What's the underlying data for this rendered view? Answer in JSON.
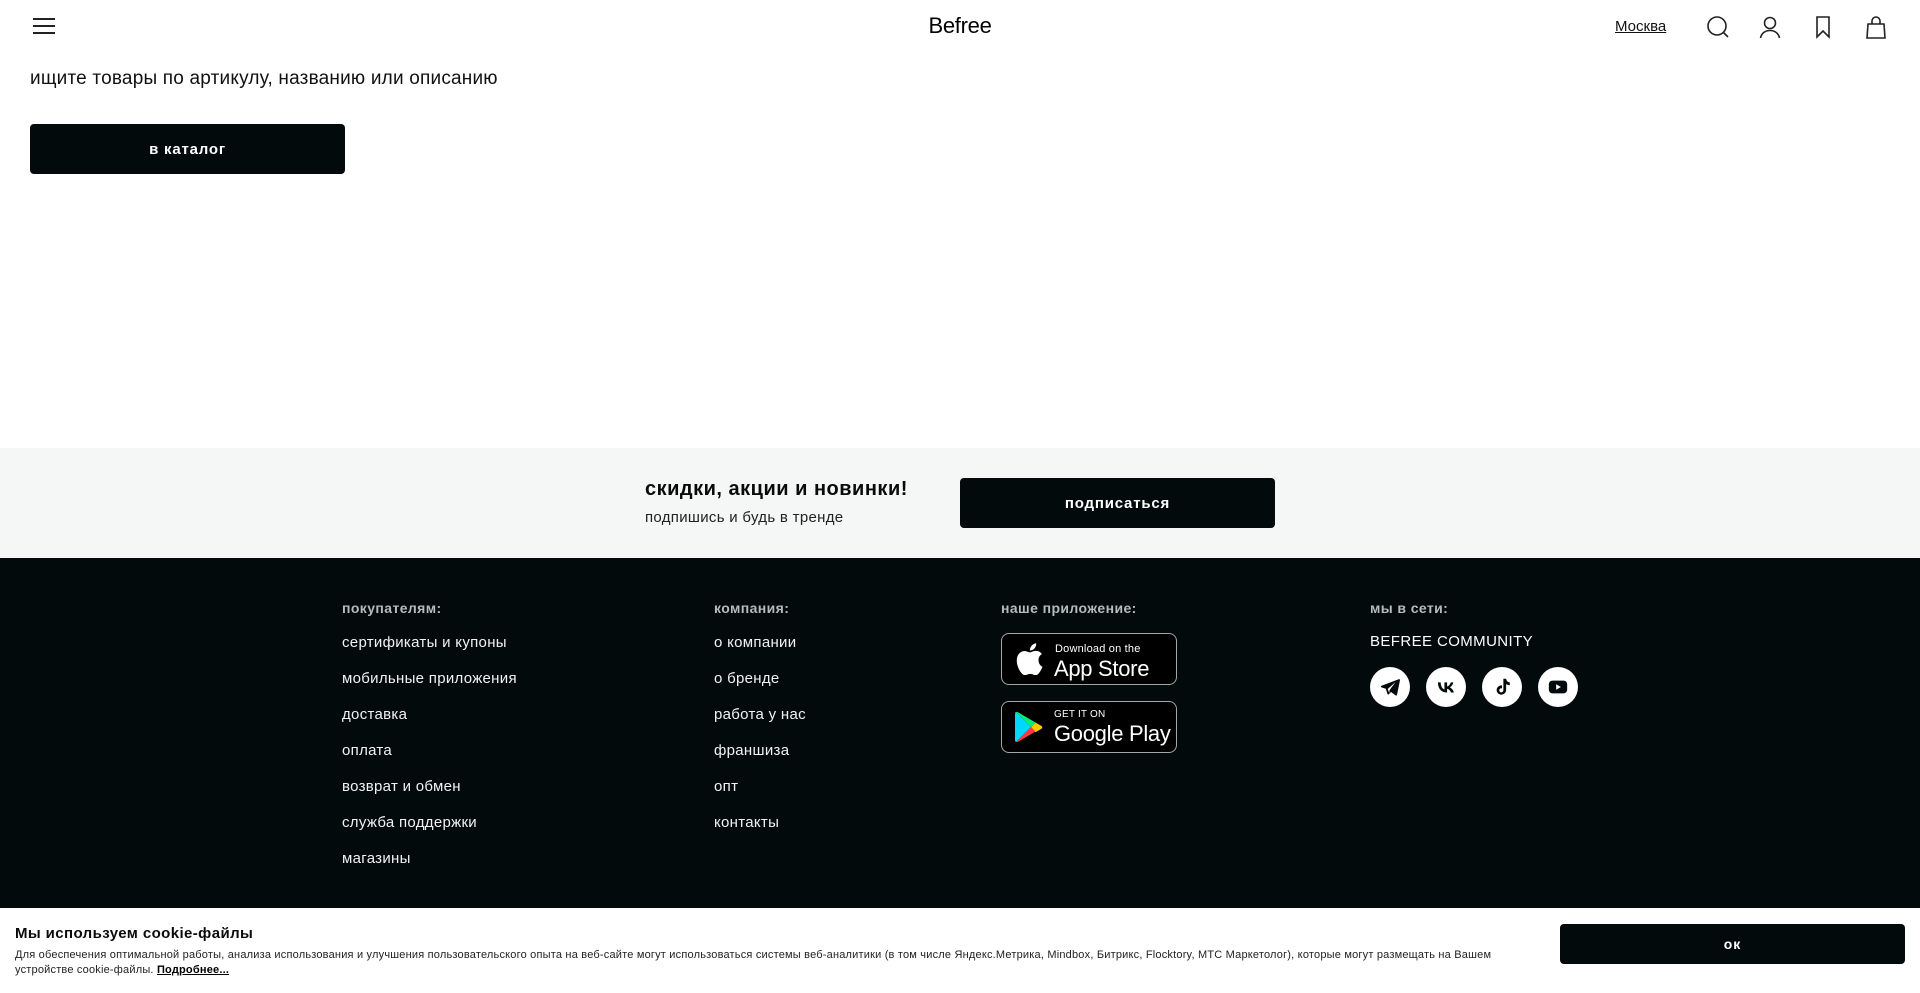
{
  "header": {
    "logo": "Befree",
    "city": "Москва",
    "icons": [
      "menu-icon",
      "search-icon",
      "user-icon",
      "bookmark-icon",
      "bag-icon"
    ]
  },
  "main": {
    "hint": "ищите товары по артикулу, названию или описанию",
    "catalog_button": "в каталог"
  },
  "subscribe": {
    "title": "скидки, акции и новинки!",
    "subtitle": "подпишись и будь в тренде",
    "button": "подписаться"
  },
  "footer": {
    "buyers": {
      "title": "покупателям:",
      "links": [
        "сертификаты и купоны",
        "мобильные приложения",
        "доставка",
        "оплата",
        "возврат и обмен",
        "служба поддержки",
        "магазины"
      ]
    },
    "company": {
      "title": "компания:",
      "links": [
        "о компании",
        "о бренде",
        "работа у нас",
        "франшиза",
        "опт",
        "контакты"
      ]
    },
    "app": {
      "title": "наше приложение:",
      "appstore_small": "Download on the",
      "appstore_big": "App Store",
      "googleplay_small": "GET IT ON",
      "googleplay_big": "Google Play"
    },
    "social": {
      "title": "мы в сети:",
      "community": "BEFREE COMMUNITY",
      "icons": [
        "telegram-icon",
        "vk-icon",
        "tiktok-icon",
        "youtube-icon"
      ]
    }
  },
  "cookie": {
    "title": "Мы используем cookie-файлы",
    "text": "Для обеспечения оптимальной работы, анализа использования и улучшения пользовательского опыта на веб-сайте могут использоваться системы веб-аналитики (в том числе Яндекс.Метрика, Mindbox, Битрикс, Flocktory, МТС Маркетолог), которые могут размещать на Вашем устройстве cookie-файлы.",
    "more": "Подробнее...",
    "ok": "ок"
  },
  "colors": {
    "dark": "#030a0b",
    "subscribe_bg": "#f5f6f6",
    "footer_title": "#b6bcbd"
  }
}
